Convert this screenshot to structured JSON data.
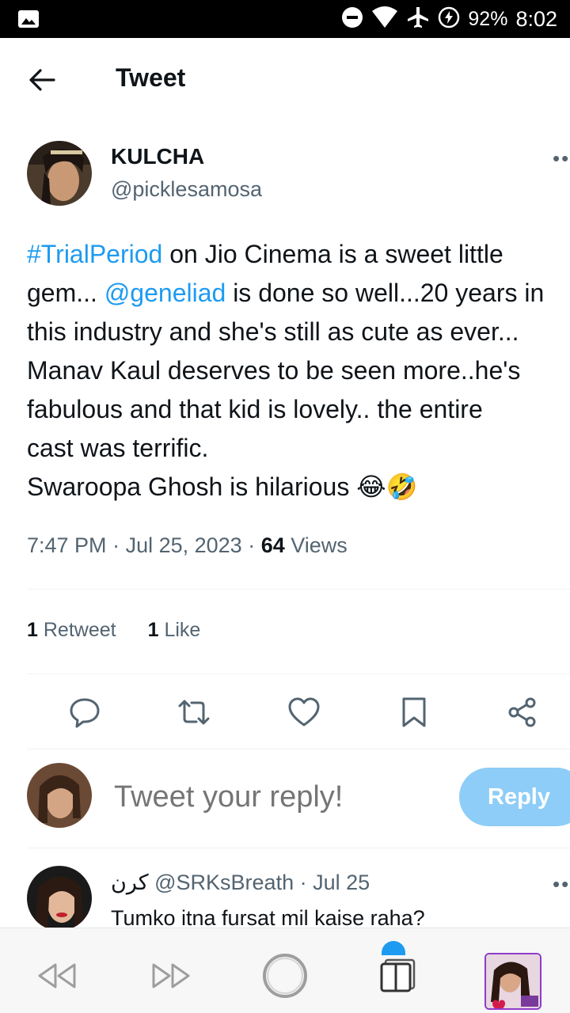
{
  "status_bar": {
    "battery": "92%",
    "time": "8:02"
  },
  "header": {
    "title": "Tweet"
  },
  "tweet": {
    "author_name": "KULCHA",
    "author_handle": "@picklesamosa",
    "hashtag": "#TrialPeriod",
    "line1_rest": " on Jio Cinema is a sweet little",
    "line2_start": "gem... ",
    "mention": "@geneliad",
    "line2_rest": " is done so well...20 years in",
    "line3": "this industry and she's still as cute as ever...",
    "line4": "Manav Kaul deserves to be seen more..he's",
    "line5": "fabulous and that kid is lovely.. the entire",
    "line6": "cast was terrific.",
    "line7": "Swaroopa Ghosh is hilarious 😂🤣",
    "time": "7:47 PM",
    "date": "Jul 25, 2023",
    "views_count": "64",
    "views_label": "Views",
    "retweets_count": "1",
    "retweets_label": "Retweet",
    "likes_count": "1",
    "likes_label": "Like"
  },
  "composer": {
    "placeholder": "Tweet your reply!",
    "button": "Reply"
  },
  "reply": {
    "name": "کرن",
    "handle": "@SRKsBreath",
    "date": "Jul 25",
    "text": "Tumko itna fursat mil kaise raha?"
  },
  "colors": {
    "accent": "#1d9bf0",
    "reply_button": "#8ecdf7",
    "secondary_text": "#536471"
  }
}
